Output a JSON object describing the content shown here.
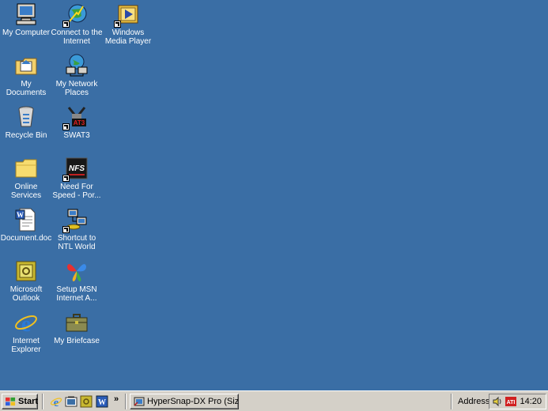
{
  "desktop": {
    "icons": [
      {
        "label": "My Computer"
      },
      {
        "label": "Connect to the Internet"
      },
      {
        "label": "Windows Media Player"
      },
      {
        "label": "My Documents"
      },
      {
        "label": "My Network Places"
      },
      {
        "label": "Recycle Bin"
      },
      {
        "label": "SWAT3"
      },
      {
        "label": "Online Services"
      },
      {
        "label": "Need For Speed - Por..."
      },
      {
        "label": "Document.doc"
      },
      {
        "label": "Shortcut to NTL World"
      },
      {
        "label": "Microsoft Outlook"
      },
      {
        "label": "Setup MSN Internet A..."
      },
      {
        "label": "Internet Explorer"
      },
      {
        "label": "My Briefcase"
      }
    ]
  },
  "taskbar": {
    "start_label": "Start",
    "more_chevron": "»",
    "task_button_label": "HyperSnap-DX Pro (Size: ...",
    "address_label": "Address",
    "clock": "14:20",
    "quick_launch": [
      "internet-explorer-icon",
      "desktop-icon",
      "outlook-icon",
      "word-icon"
    ]
  },
  "colors": {
    "desktop_background": "#3a6ea5",
    "taskbar": "#d4d0c8"
  }
}
